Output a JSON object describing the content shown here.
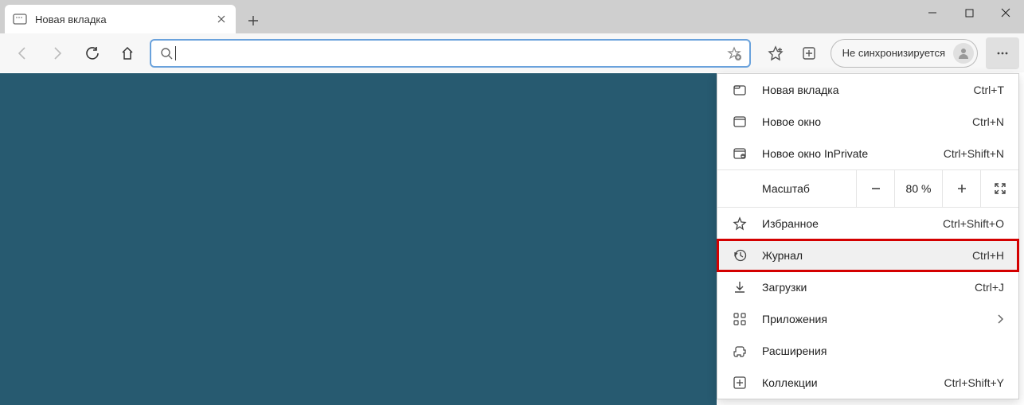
{
  "tab": {
    "title": "Новая вкладка"
  },
  "sync": {
    "label": "Не синхронизируется"
  },
  "addressbar": {
    "value": "",
    "placeholder": ""
  },
  "menu": {
    "new_tab": {
      "label": "Новая вкладка",
      "shortcut": "Ctrl+T"
    },
    "new_window": {
      "label": "Новое окно",
      "shortcut": "Ctrl+N"
    },
    "inprivate": {
      "label": "Новое окно InPrivate",
      "shortcut": "Ctrl+Shift+N"
    },
    "zoom": {
      "label": "Масштаб",
      "value": "80 %"
    },
    "favorites": {
      "label": "Избранное",
      "shortcut": "Ctrl+Shift+O"
    },
    "history": {
      "label": "Журнал",
      "shortcut": "Ctrl+H"
    },
    "downloads": {
      "label": "Загрузки",
      "shortcut": "Ctrl+J"
    },
    "apps": {
      "label": "Приложения"
    },
    "extensions": {
      "label": "Расширения"
    },
    "collections": {
      "label": "Коллекции",
      "shortcut": "Ctrl+Shift+Y"
    }
  }
}
